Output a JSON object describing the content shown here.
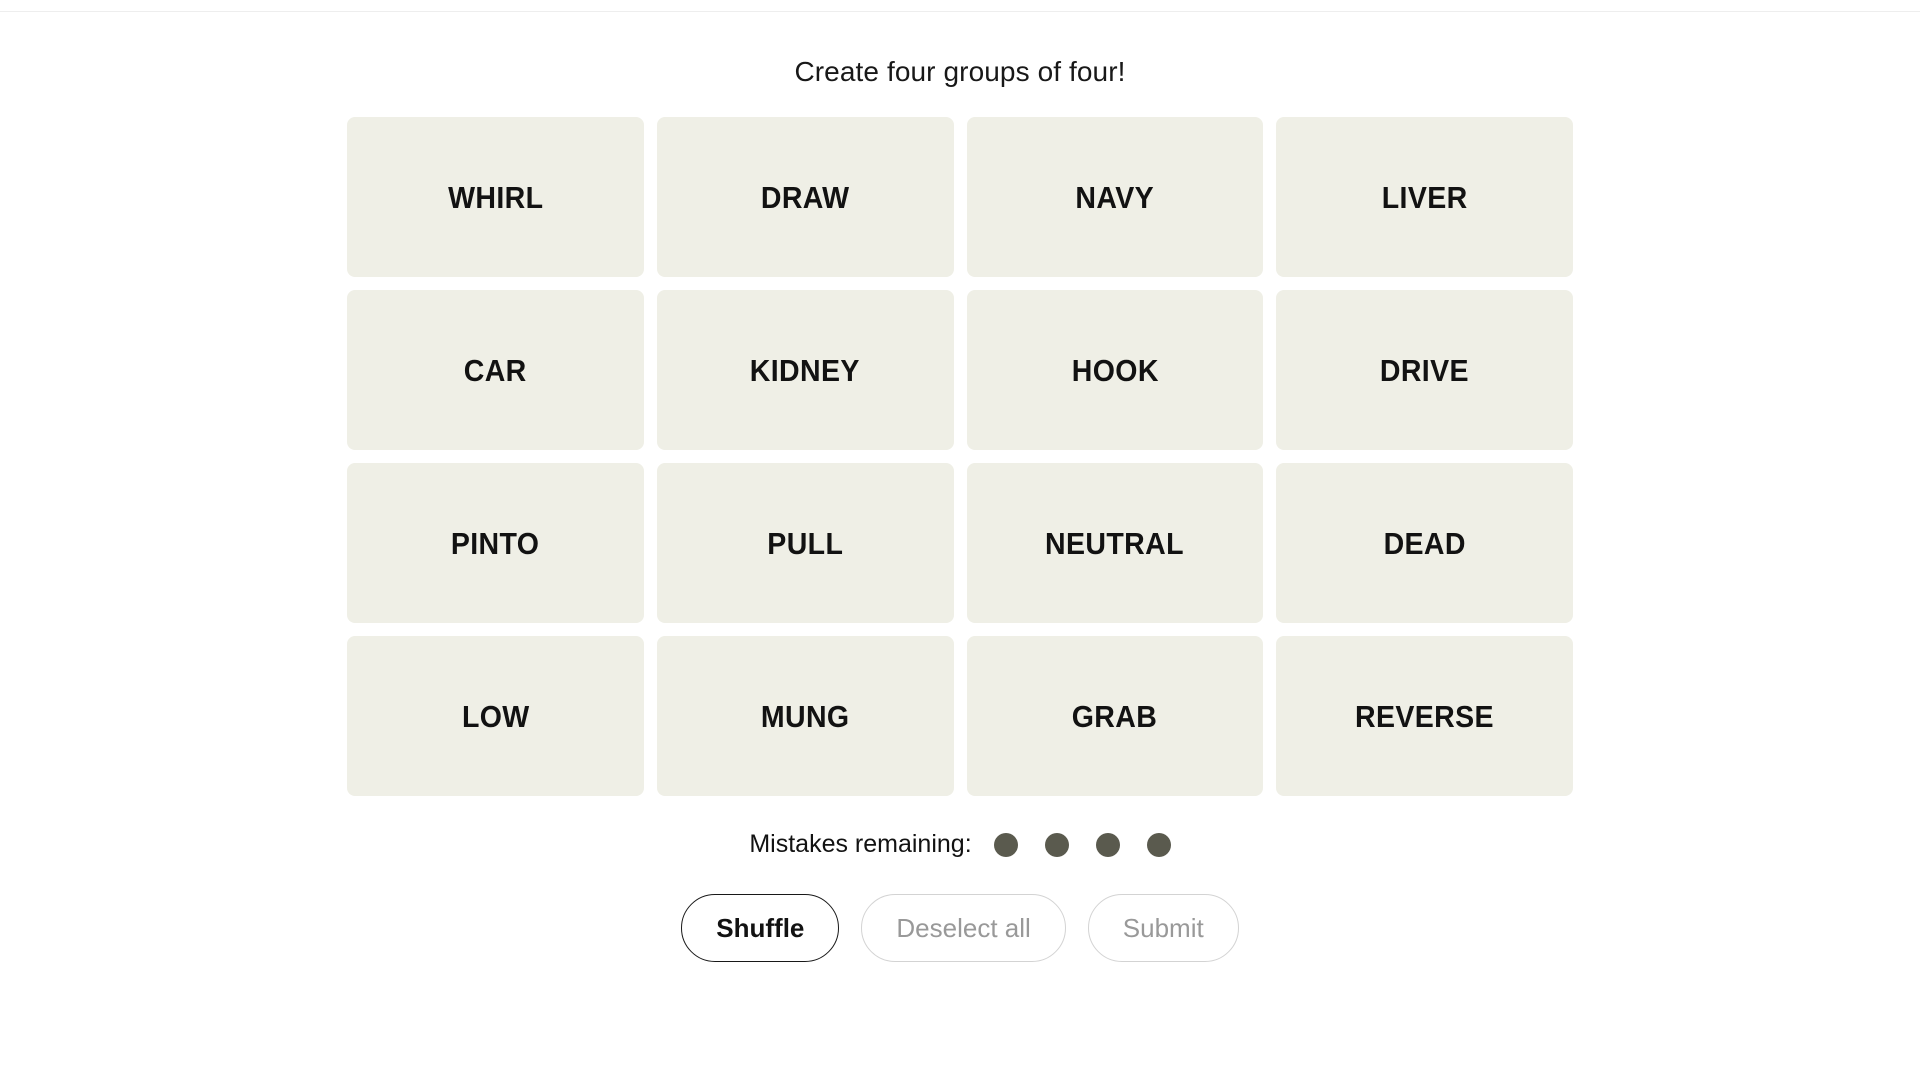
{
  "page": {
    "instruction": "Create four groups of four!",
    "background_color": "#ffffff",
    "divider_color": "#eeeeee"
  },
  "board": {
    "rows": 4,
    "columns": 4,
    "tile_background_color": "#efefe6",
    "tile_text_color": "#121212",
    "tiles": [
      {
        "label": "WHIRL"
      },
      {
        "label": "DRAW"
      },
      {
        "label": "NAVY"
      },
      {
        "label": "LIVER"
      },
      {
        "label": "CAR"
      },
      {
        "label": "KIDNEY"
      },
      {
        "label": "HOOK"
      },
      {
        "label": "DRIVE"
      },
      {
        "label": "PINTO"
      },
      {
        "label": "PULL"
      },
      {
        "label": "NEUTRAL"
      },
      {
        "label": "DEAD"
      },
      {
        "label": "LOW"
      },
      {
        "label": "MUNG"
      },
      {
        "label": "GRAB"
      },
      {
        "label": "REVERSE"
      }
    ]
  },
  "mistakes": {
    "label": "Mistakes remaining:",
    "remaining": 4,
    "dot_color": "#5a5a4e",
    "dots": [
      1,
      2,
      3,
      4
    ]
  },
  "controls": {
    "shuffle": {
      "label": "Shuffle",
      "state": "enabled"
    },
    "deselect_all": {
      "label": "Deselect all",
      "state": "disabled"
    },
    "submit": {
      "label": "Submit",
      "state": "disabled"
    }
  }
}
